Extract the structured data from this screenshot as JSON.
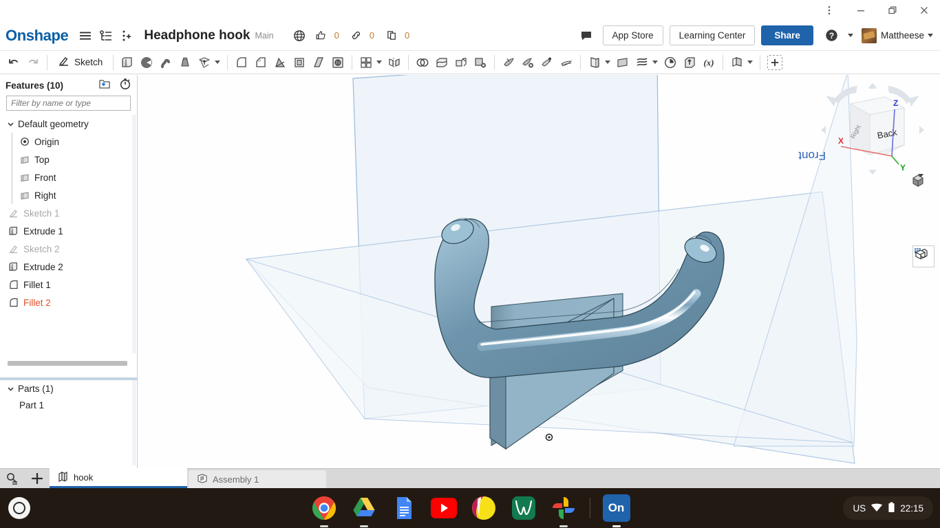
{
  "window": {
    "menu_icon": "kebab-menu-icon",
    "minimize_label": "Minimize",
    "restore_label": "Restore",
    "close_label": "Close"
  },
  "header": {
    "logo": "Onshape",
    "hamburger": "hamburger-menu-icon",
    "version_graph": "version-graph-icon",
    "add_branch": "branch-add-icon",
    "doc_title": "Headphone hook",
    "branch": "Main",
    "counters": {
      "globe": "globe-icon",
      "likes_icon": "thumbs-up-icon",
      "likes": "0",
      "links_icon": "link-icon",
      "links": "0",
      "copies_icon": "copy-icon",
      "copies": "0"
    },
    "comment_icon": "comment-icon",
    "app_store": "App Store",
    "learning_center": "Learning Center",
    "share": "Share",
    "help_icon": "help-icon",
    "user_name": "Mattheese"
  },
  "toolbar": {
    "undo": "undo-icon",
    "redo": "redo-icon",
    "sketch": "Sketch",
    "items": [
      "extrude-icon",
      "revolve-icon",
      "sweep-icon",
      "loft-icon",
      "thicken-icon",
      "fillet-icon",
      "chamfer-icon",
      "draft-icon",
      "shell-icon",
      "rib-icon",
      "hole-icon",
      "linear-pattern-icon",
      "mirror-icon",
      "boolean-icon",
      "enclose-icon",
      "transform-icon",
      "delete-part-icon",
      "split-icon",
      "delete-face-icon",
      "move-face-icon",
      "offset-surface-icon",
      "surface-fill-icon",
      "plane-icon",
      "curve-icon",
      "sketch-history-icon",
      "import-derived-icon",
      "variable-icon",
      "composite-part-icon"
    ],
    "add_custom": "add-custom-feature-icon"
  },
  "features_panel": {
    "title": "Features (10)",
    "new_folder_icon": "new-folder-icon",
    "rollback_timer_icon": "rollback-timer-icon",
    "filter_placeholder": "Filter by name or type",
    "filter_value": "",
    "tree": [
      {
        "label": "Default geometry",
        "icon": "chevron-down-icon",
        "level": 0,
        "state": "normal"
      },
      {
        "label": "Origin",
        "icon": "origin-icon",
        "level": 1,
        "state": "normal"
      },
      {
        "label": "Top",
        "icon": "plane-icon",
        "level": 1,
        "state": "normal"
      },
      {
        "label": "Front",
        "icon": "plane-icon",
        "level": 1,
        "state": "normal"
      },
      {
        "label": "Right",
        "icon": "plane-icon",
        "level": 1,
        "state": "normal"
      },
      {
        "label": "Sketch 1",
        "icon": "sketch-icon",
        "level": 0,
        "state": "dim"
      },
      {
        "label": "Extrude 1",
        "icon": "extrude-icon",
        "level": 0,
        "state": "normal"
      },
      {
        "label": "Sketch 2",
        "icon": "sketch-icon",
        "level": 0,
        "state": "dim"
      },
      {
        "label": "Extrude 2",
        "icon": "extrude-icon",
        "level": 0,
        "state": "normal"
      },
      {
        "label": "Fillet 1",
        "icon": "fillet-icon",
        "level": 0,
        "state": "normal"
      },
      {
        "label": "Fillet 2",
        "icon": "fillet-icon",
        "level": 0,
        "state": "error"
      }
    ],
    "parts": {
      "title": "Parts (1)",
      "items": [
        {
          "label": "Part 1"
        }
      ]
    }
  },
  "canvas": {
    "view_cube": {
      "front_label": "Front",
      "back_label": "Back",
      "axis_x": "X",
      "axis_y": "Y",
      "axis_z": "Z",
      "axis_x_color": "#e03030",
      "axis_y_color": "#18a018",
      "axis_z_color": "#2b3fd0"
    },
    "view_mode_icon": "shaded-view-icon",
    "render_panel_icon": "appearance-panel-icon",
    "plane_fill": "#eef4fa",
    "plane_stroke": "#8fb4d9",
    "part_color": "#8fb4cc"
  },
  "tabbar": {
    "search_icon": "tab-search-icon",
    "add_icon": "add-tab-icon",
    "tabs": [
      {
        "label": "hook",
        "icon": "part-studio-icon",
        "active": true
      },
      {
        "label": "Assembly 1",
        "icon": "assembly-icon",
        "active": false
      }
    ]
  },
  "taskbar": {
    "launcher": "launcher-icon",
    "apps": [
      {
        "name": "chrome-icon",
        "running": true
      },
      {
        "name": "google-drive-icon",
        "running": true
      },
      {
        "name": "google-docs-icon",
        "running": false
      },
      {
        "name": "youtube-icon",
        "running": false
      },
      {
        "name": "color-app-icon",
        "running": false
      },
      {
        "name": "desmos-icon",
        "running": false
      },
      {
        "name": "google-photos-icon",
        "running": true
      },
      {
        "name": "onshape-icon",
        "running": true,
        "label": "On"
      }
    ],
    "status": {
      "keyboard": "US",
      "wifi_icon": "wifi-icon",
      "battery_icon": "battery-icon",
      "time": "22:15"
    }
  }
}
